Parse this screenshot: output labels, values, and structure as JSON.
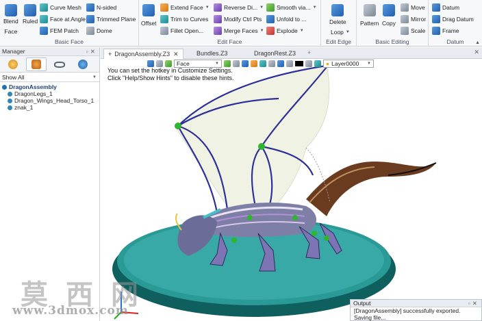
{
  "ribbon": {
    "groups": {
      "basic_face": {
        "label": "Basic Face",
        "blend": "Blend",
        "blend_sub": "Face",
        "ruled": "Ruled",
        "curve_mesh": "Curve Mesh",
        "n_sided": "N-sided",
        "face_at_angle": "Face at Angle",
        "trimmed_plane": "Trimmed Plane",
        "fem_patch": "FEM Patch",
        "dome": "Dome"
      },
      "edit_face": {
        "label": "Edit Face",
        "offset": "Offset",
        "extend_face": "Extend Face",
        "reverse_dir": "Reverse Di...",
        "smooth_via": "Smooth via...",
        "trim_to_curves": "Trim to Curves",
        "modify_ctrl_pts": "Modify Ctrl Pts",
        "unfold_to": "Unfold to ...",
        "fillet_open": "Fillet Open...",
        "merge_faces": "Merge Faces",
        "explode": "Explode"
      },
      "edit_edge": {
        "label": "Edit Edge",
        "delete": "Delete",
        "loop": "Loop"
      },
      "basic_editing": {
        "label": "Basic Editing",
        "pattern": "Pattern",
        "copy": "Copy",
        "move": "Move",
        "mirror": "Mirror",
        "scale": "Scale"
      },
      "datum": {
        "label": "Datum",
        "datum": "Datum",
        "drag_datum": "Drag Datum",
        "frame": "Frame"
      }
    }
  },
  "manager": {
    "title": "Manager",
    "filter": "Show All",
    "tree": {
      "root": "DragonAssembly",
      "children": [
        "DragonLegs_1",
        "Dragon_Wings_Head_Torso_1",
        "znak_1"
      ]
    }
  },
  "document_tabs": [
    "DragonAssembly.Z3",
    "Bundles.Z3",
    "DragonRest.Z3"
  ],
  "viewport": {
    "hint_line_1": "You can set the hotkey in Customize Settings.",
    "hint_line_2": "Click \"Help/Show Hints\" to disable these hints.",
    "filter_value": "Face",
    "layer_value": "Layer0000"
  },
  "output": {
    "title": "Output",
    "lines": [
      "[DragonAssembly] successfully exported.",
      "Saving file..."
    ]
  },
  "watermark": {
    "chinese": "莫西网",
    "url": "www.3dmox.com"
  }
}
